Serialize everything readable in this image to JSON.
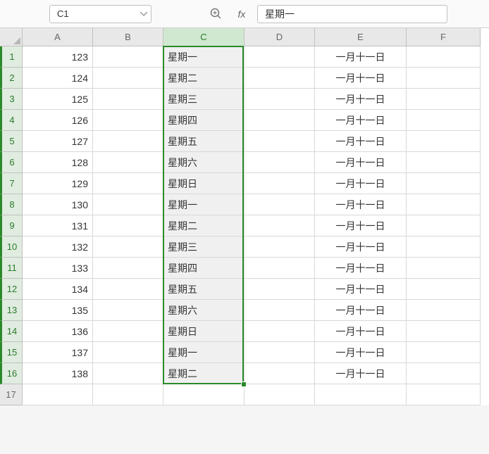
{
  "name_box": "C1",
  "formula_bar": "星期一",
  "columns": [
    "A",
    "B",
    "C",
    "D",
    "E",
    "F"
  ],
  "selected_col_index": 2,
  "selection": {
    "col": "C",
    "row_start": 1,
    "row_end": 16
  },
  "rows": [
    {
      "n": "1",
      "A": "123",
      "B": "",
      "C": "星期一",
      "D": "",
      "E": "一月十一日",
      "F": ""
    },
    {
      "n": "2",
      "A": "124",
      "B": "",
      "C": "星期二",
      "D": "",
      "E": "一月十一日",
      "F": ""
    },
    {
      "n": "3",
      "A": "125",
      "B": "",
      "C": "星期三",
      "D": "",
      "E": "一月十一日",
      "F": ""
    },
    {
      "n": "4",
      "A": "126",
      "B": "",
      "C": "星期四",
      "D": "",
      "E": "一月十一日",
      "F": ""
    },
    {
      "n": "5",
      "A": "127",
      "B": "",
      "C": "星期五",
      "D": "",
      "E": "一月十一日",
      "F": ""
    },
    {
      "n": "6",
      "A": "128",
      "B": "",
      "C": "星期六",
      "D": "",
      "E": "一月十一日",
      "F": ""
    },
    {
      "n": "7",
      "A": "129",
      "B": "",
      "C": "星期日",
      "D": "",
      "E": "一月十一日",
      "F": ""
    },
    {
      "n": "8",
      "A": "130",
      "B": "",
      "C": "星期一",
      "D": "",
      "E": "一月十一日",
      "F": ""
    },
    {
      "n": "9",
      "A": "131",
      "B": "",
      "C": "星期二",
      "D": "",
      "E": "一月十一日",
      "F": ""
    },
    {
      "n": "10",
      "A": "132",
      "B": "",
      "C": "星期三",
      "D": "",
      "E": "一月十一日",
      "F": ""
    },
    {
      "n": "11",
      "A": "133",
      "B": "",
      "C": "星期四",
      "D": "",
      "E": "一月十一日",
      "F": ""
    },
    {
      "n": "12",
      "A": "134",
      "B": "",
      "C": "星期五",
      "D": "",
      "E": "一月十一日",
      "F": ""
    },
    {
      "n": "13",
      "A": "135",
      "B": "",
      "C": "星期六",
      "D": "",
      "E": "一月十一日",
      "F": ""
    },
    {
      "n": "14",
      "A": "136",
      "B": "",
      "C": "星期日",
      "D": "",
      "E": "一月十一日",
      "F": ""
    },
    {
      "n": "15",
      "A": "137",
      "B": "",
      "C": "星期一",
      "D": "",
      "E": "一月十一日",
      "F": ""
    },
    {
      "n": "16",
      "A": "138",
      "B": "",
      "C": "星期二",
      "D": "",
      "E": "一月十一日",
      "F": ""
    },
    {
      "n": "17",
      "A": "",
      "B": "",
      "C": "",
      "D": "",
      "E": "",
      "F": ""
    }
  ]
}
